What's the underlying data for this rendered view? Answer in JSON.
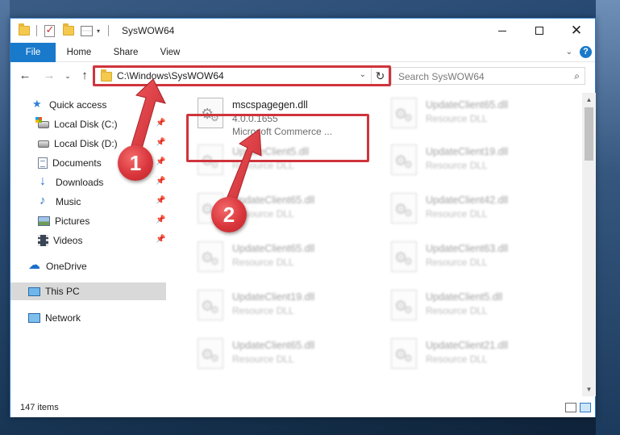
{
  "window": {
    "title": "SysWOW64"
  },
  "ribbon": {
    "tabs": [
      {
        "label": "File",
        "active": true
      },
      {
        "label": "Home"
      },
      {
        "label": "Share"
      },
      {
        "label": "View"
      }
    ],
    "help_label": "?"
  },
  "address_bar": {
    "path": "C:\\Windows\\SysWOW64",
    "search_placeholder": "Search SysWOW64"
  },
  "sidebar": {
    "items": [
      {
        "label": "Quick access",
        "icon": "star-icon",
        "pinned": false
      },
      {
        "label": "Local Disk (C:)",
        "icon": "drive-icon",
        "pinned": true
      },
      {
        "label": "Local Disk (D:)",
        "icon": "drive-icon",
        "pinned": true
      },
      {
        "label": "Documents",
        "icon": "documents-icon",
        "pinned": true
      },
      {
        "label": "Downloads",
        "icon": "download-icon",
        "pinned": true
      },
      {
        "label": "Music",
        "icon": "music-icon",
        "pinned": true
      },
      {
        "label": "Pictures",
        "icon": "pictures-icon",
        "pinned": true
      },
      {
        "label": "Videos",
        "icon": "videos-icon",
        "pinned": true
      },
      {
        "label": "OneDrive",
        "icon": "onedrive-icon",
        "pinned": false
      },
      {
        "label": "This PC",
        "icon": "pc-icon",
        "pinned": false,
        "selected": true
      },
      {
        "label": "Network",
        "icon": "network-icon",
        "pinned": false
      }
    ]
  },
  "files": {
    "highlighted": {
      "name": "mscspagegen.dll",
      "version": "4.0.0.1655",
      "description": "Microsoft Commerce ..."
    },
    "blurred_left": [
      {
        "name": "UpdateClient5.dll",
        "type": "Resource DLL"
      },
      {
        "name": "UpdateClient65.dll",
        "type": "Resource DLL"
      },
      {
        "name": "UpdateClient65.dll",
        "type": "Resource DLL"
      },
      {
        "name": "UpdateClient19.dll",
        "type": "Resource DLL"
      },
      {
        "name": "UpdateClient65.dll",
        "type": "Resource DLL"
      }
    ],
    "blurred_right": [
      {
        "name": "UpdateClient65.dll",
        "type": "Resource DLL"
      },
      {
        "name": "UpdateClient19.dll",
        "type": "Resource DLL"
      },
      {
        "name": "UpdateClient42.dll",
        "type": "Resource DLL"
      },
      {
        "name": "UpdateClient63.dll",
        "type": "Resource DLL"
      },
      {
        "name": "UpdateClient5.dll",
        "type": "Resource DLL"
      },
      {
        "name": "UpdateClient21.dll",
        "type": "Resource DLL"
      }
    ]
  },
  "status": {
    "item_count": "147 items"
  },
  "annotations": {
    "step1": "1",
    "step2": "2",
    "color": "#d0343c"
  }
}
